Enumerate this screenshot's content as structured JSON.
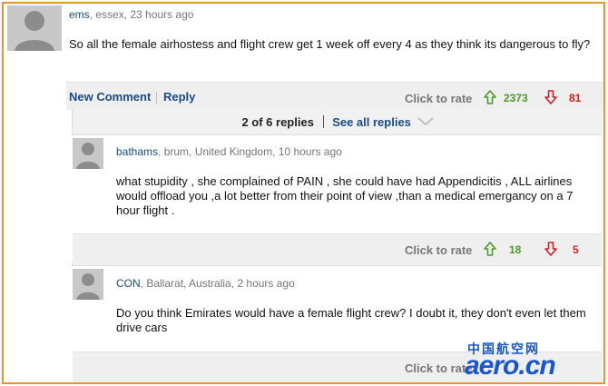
{
  "main_comment": {
    "username": "ems",
    "meta": ", essex, 23 hours ago",
    "text": "So all the female airhostess and flight crew get 1 week off every 4 as they think its dangerous to fly?",
    "new_comment_label": "New Comment",
    "reply_label": "Reply",
    "rate_label": "Click to rate",
    "up_count": "2373",
    "down_count": "81"
  },
  "replies": {
    "count_label": "2 of 6 replies",
    "see_all_label": "See all replies",
    "items": [
      {
        "username": "bathams",
        "meta": ", brum, United Kingdom, 10 hours ago",
        "text": "what stupidity , she complained of PAIN , she could have had Appendicitis , ALL airlines would offload you ,a lot better from their point of view ,than a medical emergancy on a 7 hour flight .",
        "rate_label": "Click to rate",
        "up_count": "18",
        "down_count": "5"
      },
      {
        "username": "CON",
        "meta": ", Ballarat, Australia, 2 hours ago",
        "text": "Do you think Emirates would have a female flight crew? I doubt it, they don't even let them drive cars",
        "rate_label": "Click to rate"
      }
    ]
  },
  "watermark": {
    "chinese": "中国航空网",
    "domain": "aero.cn"
  },
  "colors": {
    "frame_border": "#e8932b",
    "link": "#1a4a86",
    "up": "#4a9a2a",
    "down": "#d32020"
  }
}
